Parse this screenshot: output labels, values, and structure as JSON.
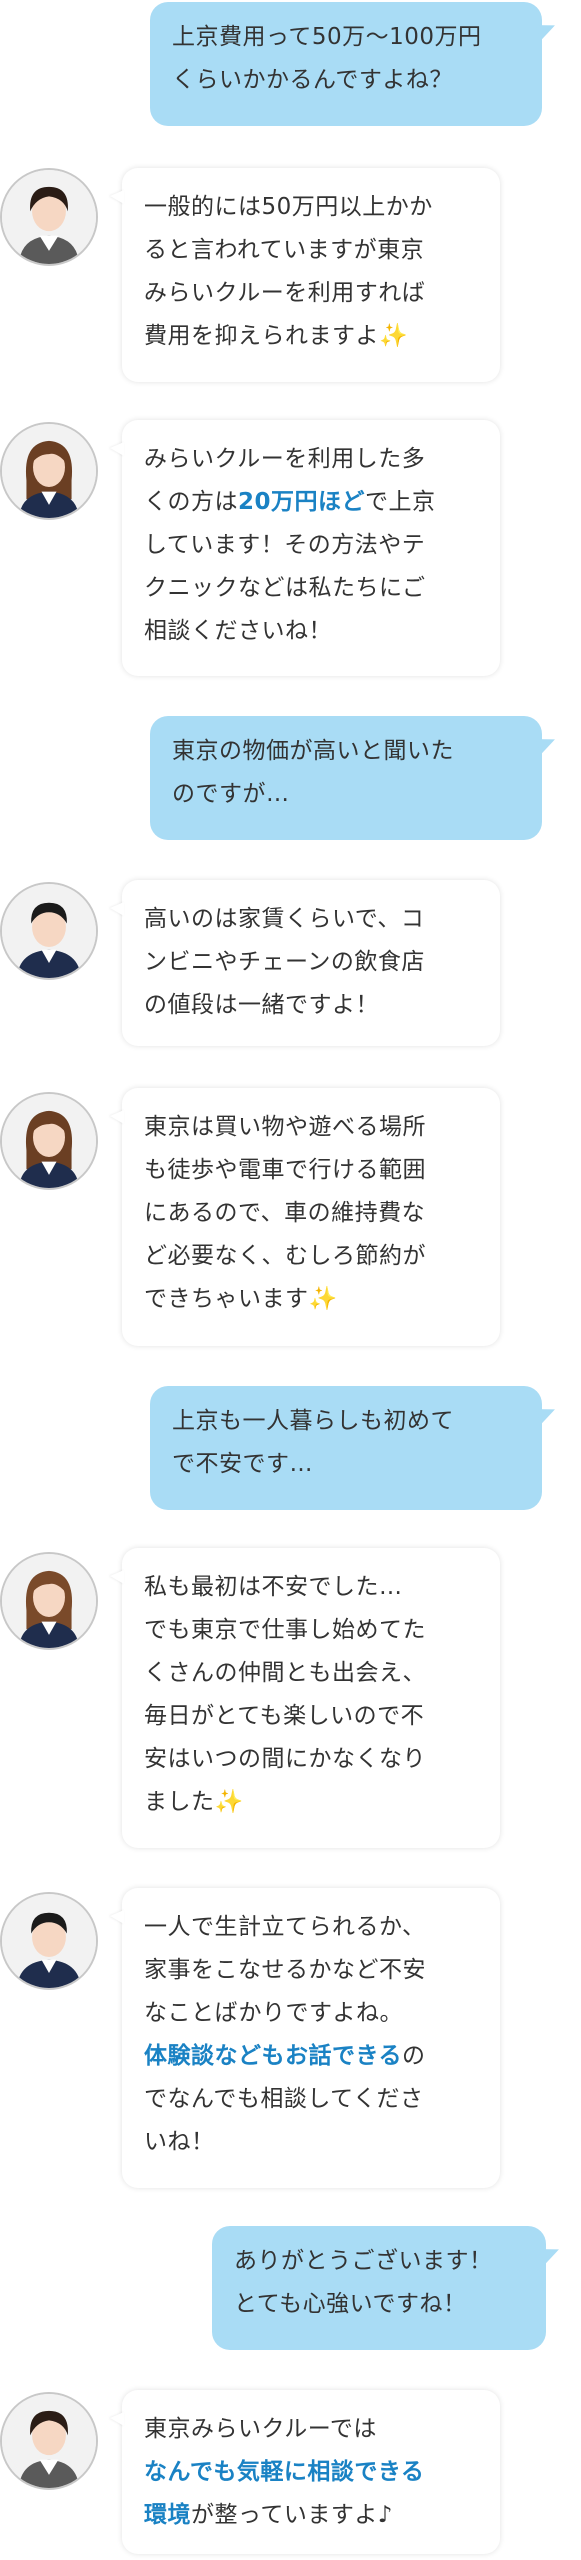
{
  "messages": [
    {
      "type": "user",
      "lines": [
        "上京費用って50万〜100万円",
        "くらいかかるんですよね？"
      ]
    },
    {
      "type": "staff",
      "avatar": "staff-woman-short-hair",
      "lines": [
        "一般的には50万円以上かか",
        "ると言われていますが東京",
        "みらいクルーを利用すれば",
        "費用を抑えられますよ✨"
      ]
    },
    {
      "type": "staff",
      "avatar": "staff-woman-long-hair",
      "parts": [
        {
          "t": "みらいクルーを利用した多"
        },
        {
          "br": true
        },
        {
          "t": "くの方は"
        },
        {
          "t": "20万円ほど",
          "hl": true
        },
        {
          "t": "で上京"
        },
        {
          "br": true
        },
        {
          "t": "しています！その方法やテ"
        },
        {
          "br": true
        },
        {
          "t": "クニックなどは私たちにご"
        },
        {
          "br": true
        },
        {
          "t": "相談くださいね！"
        }
      ]
    },
    {
      "type": "user",
      "lines": [
        "東京の物価が高いと聞いた",
        "のですが…"
      ]
    },
    {
      "type": "staff",
      "avatar": "staff-man-dark-hair",
      "lines": [
        "高いのは家賃くらいで、コ",
        "ンビニやチェーンの飲食店",
        "の値段は一緒ですよ！"
      ]
    },
    {
      "type": "staff",
      "avatar": "staff-woman-long-hair",
      "lines": [
        "東京は買い物や遊べる場所",
        "も徒歩や電車で行ける範囲",
        "にあるので、車の維持費な",
        "ど必要なく、むしろ節約が",
        "できちゃいます✨"
      ]
    },
    {
      "type": "user",
      "lines": [
        "上京も一人暮らしも初めて",
        "で不安です…"
      ]
    },
    {
      "type": "staff",
      "avatar": "staff-woman-long-hair",
      "lines": [
        "私も最初は不安でした…",
        "でも東京で仕事し始めてた",
        "くさんの仲間とも出会え、",
        "毎日がとても楽しいので不",
        "安はいつの間にかなくなり",
        "ました✨"
      ]
    },
    {
      "type": "staff",
      "avatar": "staff-man-dark-hair",
      "parts": [
        {
          "t": "一人で生計立てられるか、"
        },
        {
          "br": true
        },
        {
          "t": "家事をこなせるかなど不安"
        },
        {
          "br": true
        },
        {
          "t": "なことばかりですよね。"
        },
        {
          "br": true
        },
        {
          "t": "体験談などもお話できる",
          "hl": true
        },
        {
          "t": "の"
        },
        {
          "br": true
        },
        {
          "t": "でなんでも相談してくださ"
        },
        {
          "br": true
        },
        {
          "t": "いね！"
        }
      ]
    },
    {
      "type": "user",
      "lines": [
        "ありがとうございます！",
        "とても心強いですね！"
      ]
    },
    {
      "type": "staff",
      "avatar": "staff-woman-short-hair",
      "parts": [
        {
          "t": "東京みらいクルーでは"
        },
        {
          "br": true
        },
        {
          "t": "なんでも気軽に相談できる",
          "hl": true
        },
        {
          "br": true
        },
        {
          "t": "環境",
          "hl": true
        },
        {
          "t": "が整っていますよ♪"
        }
      ]
    }
  ]
}
